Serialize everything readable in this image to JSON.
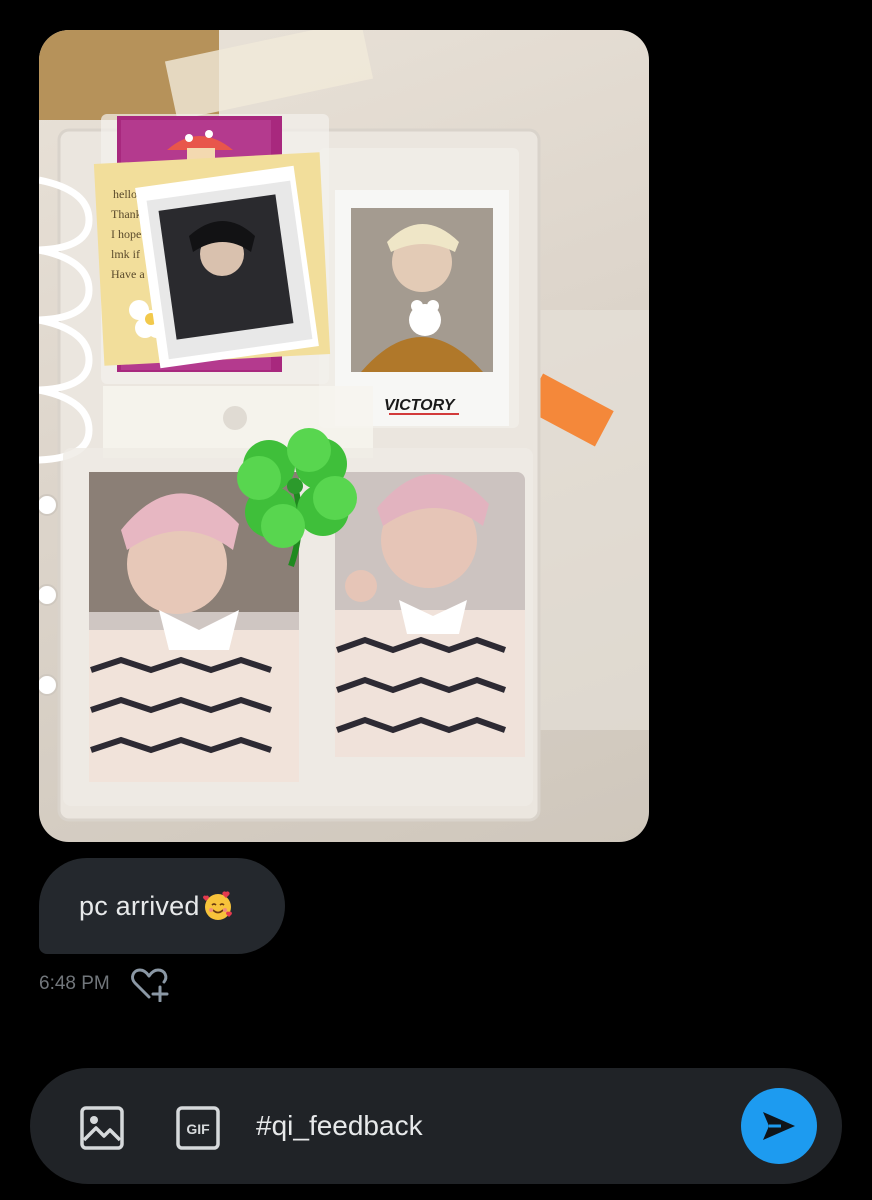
{
  "message": {
    "image": {
      "description_icon": "photo-attachment",
      "text_on_polaroid": "VICTORY"
    },
    "text": "pc arrived",
    "emoji": "smiling-face-with-hearts-icon",
    "time": "6:48 PM"
  },
  "composer": {
    "value": "#qi_feedback",
    "image_icon": "image-icon",
    "gif_label": "GIF",
    "send_icon": "send-icon"
  },
  "colors": {
    "background": "#000000",
    "bubble": "#24282d",
    "composer": "#202327",
    "accent": "#1d9bf0",
    "muted_text": "#71767b"
  }
}
